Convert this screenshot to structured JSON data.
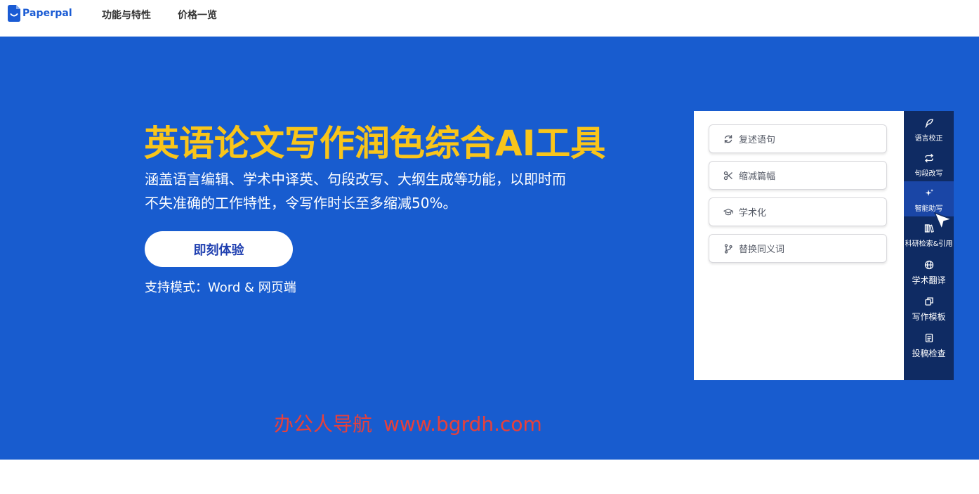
{
  "nav": {
    "logo_text": "Paperpal",
    "links": [
      "功能与特性",
      "价格一览"
    ]
  },
  "hero": {
    "title": "英语论文写作润色综合AI工具",
    "description_line1": "涵盖语言编辑、学术中译英、句段改写、大纲生成等功能，以即时而",
    "description_line2": "不失准确的工作特性，令写作时长至多缩减50%。",
    "cta_label": "即刻体验",
    "support_mode": "支持模式：Word & 网页端"
  },
  "watermark": {
    "name": "办公人导航",
    "url": "www.bgrdh.com"
  },
  "preview": {
    "options": [
      {
        "label": "复述语句",
        "icon": "refresh-icon"
      },
      {
        "label": "缩减篇幅",
        "icon": "scissors-icon"
      },
      {
        "label": "学术化",
        "icon": "graduation-cap-icon"
      },
      {
        "label": "替换同义词",
        "icon": "branch-icon"
      }
    ],
    "sidebar": [
      {
        "label": "语言校正",
        "icon": "feather-icon"
      },
      {
        "label": "句段改写",
        "icon": "repeat-icon"
      },
      {
        "label": "智能助写",
        "icon": "sparkle-icon",
        "active": true
      },
      {
        "label": "科研检索&引用",
        "icon": "books-icon"
      },
      {
        "label": "学术翻译",
        "icon": "globe-icon"
      },
      {
        "label": "写作模板",
        "icon": "copy-icon"
      },
      {
        "label": "投稿检查",
        "icon": "document-icon"
      }
    ]
  },
  "colors": {
    "hero_bg": "#185ccf",
    "title_yellow": "#f9c51a",
    "logo_blue": "#1a5bd4",
    "sidebar_bg": "#0f2b63",
    "watermark_red": "#e8403a"
  }
}
